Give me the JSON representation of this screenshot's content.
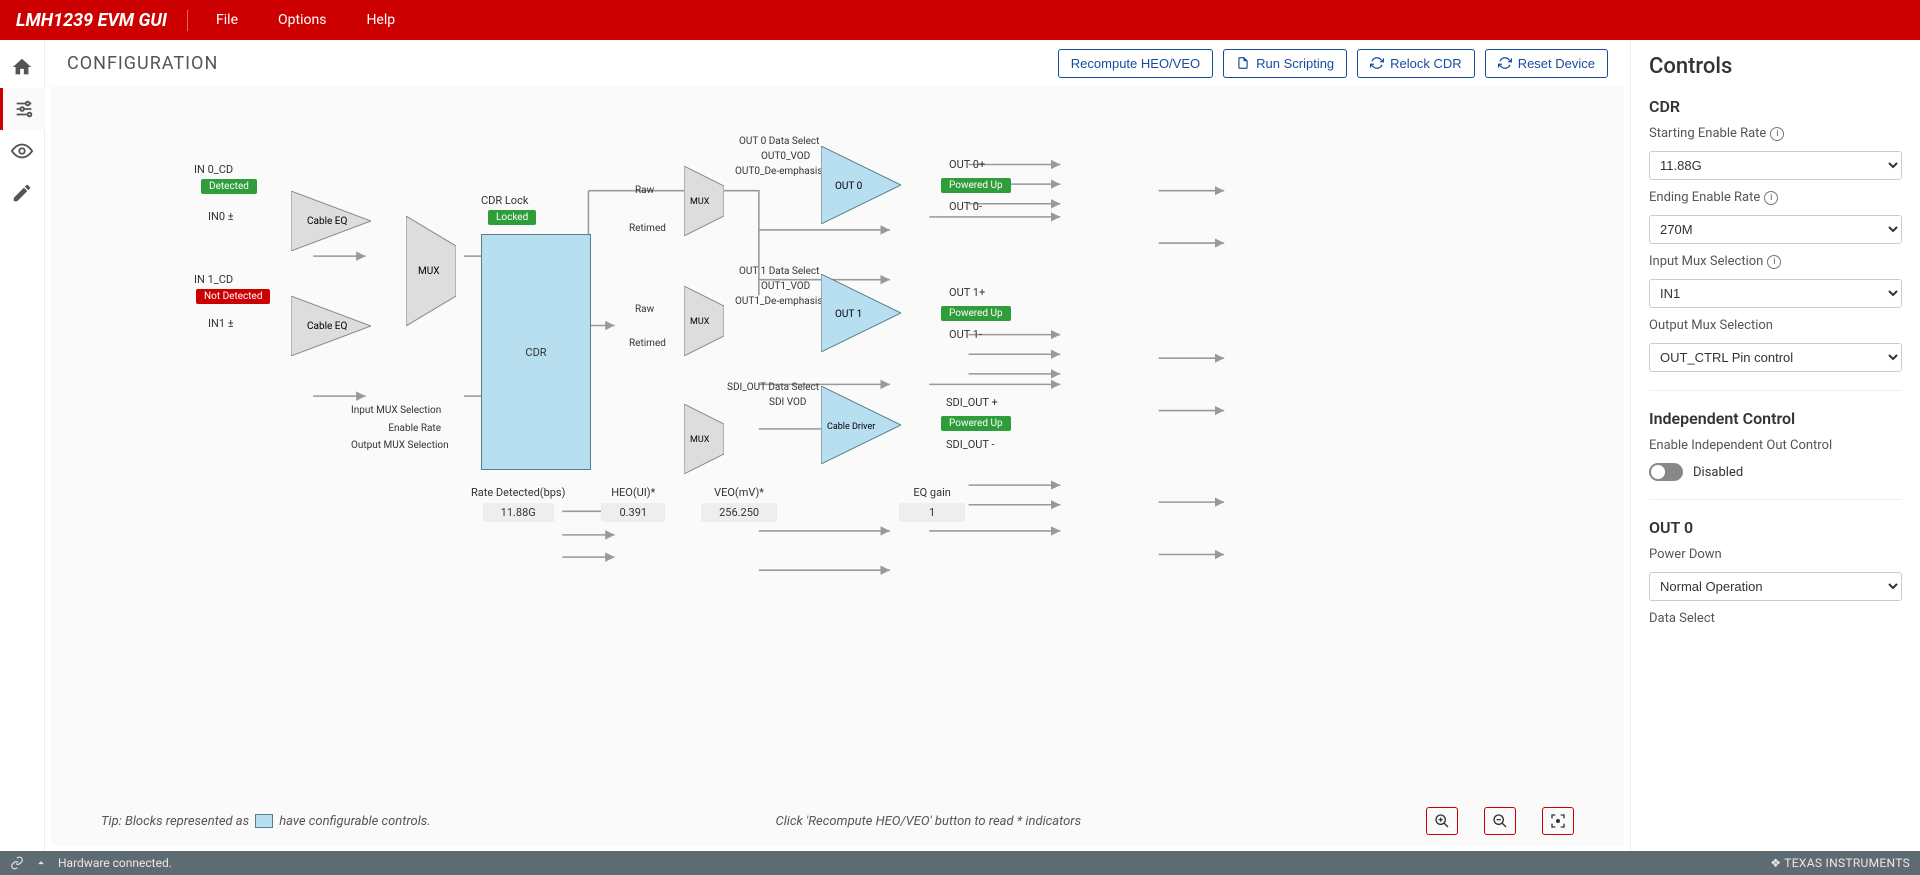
{
  "header": {
    "brand": "LMH1239 EVM GUI",
    "menu": [
      "File",
      "Options",
      "Help"
    ]
  },
  "page": {
    "title": "CONFIGURATION",
    "buttons": {
      "recompute": "Recompute HEO/VEO",
      "run": "Run Scripting",
      "relock": "Relock CDR",
      "reset": "Reset Device"
    }
  },
  "diagram": {
    "in0cd": "IN 0_CD",
    "in0cd_status": "Detected",
    "in0": "IN0 ±",
    "in1cd": "IN 1_CD",
    "in1cd_status": "Not Detected",
    "in1": "IN1 ±",
    "cable_eq": "Cable EQ",
    "mux": "MUX",
    "cdr_lock": "CDR Lock",
    "cdr_lock_status": "Locked",
    "cdr": "CDR",
    "raw": "Raw",
    "retimed": "Retimed",
    "input_mux_sel": "Input MUX Selection",
    "enable_rate": "Enable Rate",
    "output_mux_sel": "Output MUX Selection",
    "out0_params": [
      "OUT 0 Data Select",
      "OUT0_VOD",
      "OUT0_De-emphasis"
    ],
    "out1_params": [
      "OUT 1 Data Select",
      "OUT1_VOD",
      "OUT1_De-emphasis"
    ],
    "sdi_params": [
      "SDI_OUT Data Select",
      "SDI VOD"
    ],
    "out0": "OUT 0",
    "out1": "OUT 1",
    "cable_driver": "Cable Driver",
    "out0p": "OUT 0+",
    "out0n": "OUT 0-",
    "out0_status": "Powered Up",
    "out1p": "OUT 1+",
    "out1n": "OUT 1-",
    "out1_status": "Powered Up",
    "sdip": "SDI_OUT +",
    "sdin": "SDI_OUT -",
    "sdi_status": "Powered Up",
    "readouts": {
      "rate": {
        "label": "Rate Detected(bps)",
        "value": "11.88G"
      },
      "heo": {
        "label": "HEO(UI)*",
        "value": "0.391"
      },
      "veo": {
        "label": "VEO(mV)*",
        "value": "256.250"
      },
      "eq": {
        "label": "EQ gain",
        "value": "1"
      }
    },
    "tip1a": "Tip: Blocks represented as",
    "tip1b": "have configurable controls.",
    "tip2": "Click 'Recompute HEO/VEO' button to read * indicators"
  },
  "controls": {
    "title": "Controls",
    "cdr": {
      "title": "CDR",
      "start_label": "Starting Enable Rate",
      "start_value": "11.88G",
      "end_label": "Ending Enable Rate",
      "end_value": "270M",
      "inmux_label": "Input Mux Selection",
      "inmux_value": "IN1",
      "outmux_label": "Output Mux Selection",
      "outmux_value": "OUT_CTRL Pin control"
    },
    "ind": {
      "title": "Independent Control",
      "enable_label": "Enable Independent Out Control",
      "state": "Disabled"
    },
    "out0": {
      "title": "OUT 0",
      "pd_label": "Power Down",
      "pd_value": "Normal Operation",
      "ds_label": "Data Select"
    }
  },
  "footer": {
    "status": "Hardware connected.",
    "brand": "TEXAS INSTRUMENTS"
  }
}
